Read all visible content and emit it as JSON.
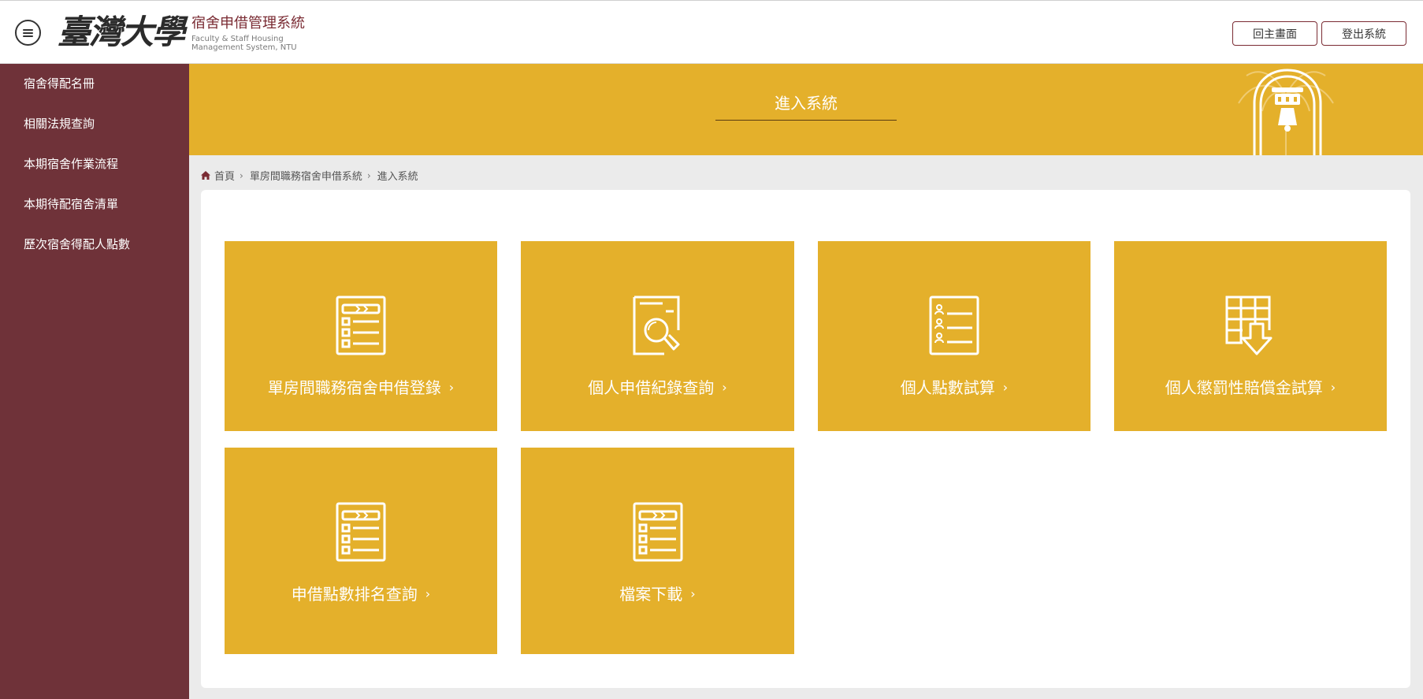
{
  "header": {
    "logo_calligraphy": "臺灣大學",
    "system_title": "宿舍申借管理系統",
    "system_subtitle_line1": "Faculty & Staff Housing",
    "system_subtitle_line2": "Management System, NTU",
    "home_button": "回主畫面",
    "logout_button": "登出系統"
  },
  "sidebar": {
    "items": [
      {
        "label": "宿舍得配名冊"
      },
      {
        "label": "相關法規查詢"
      },
      {
        "label": "本期宿舍作業流程"
      },
      {
        "label": "本期待配宿舍清單"
      },
      {
        "label": "歷次宿舍得配人點數"
      }
    ]
  },
  "banner": {
    "title": "進入系統"
  },
  "breadcrumb": {
    "items": [
      "首頁",
      "單房間職務宿舍申借系統",
      "進入系統"
    ]
  },
  "tiles": [
    {
      "label": "單房間職務宿舍申借登錄",
      "icon": "checklist-icon"
    },
    {
      "label": "個人申借紀錄查詢",
      "icon": "document-search-icon"
    },
    {
      "label": "個人點數試算",
      "icon": "person-list-icon"
    },
    {
      "label": "個人懲罰性賠償金試算",
      "icon": "table-download-icon"
    },
    {
      "label": "申借點數排名查詢",
      "icon": "checklist-icon"
    },
    {
      "label": "檔案下載",
      "icon": "checklist-icon"
    }
  ],
  "colors": {
    "sidebar_bg": "#6f3239",
    "accent_gold": "#e4b02b",
    "brand_maroon": "#7a2b33"
  }
}
